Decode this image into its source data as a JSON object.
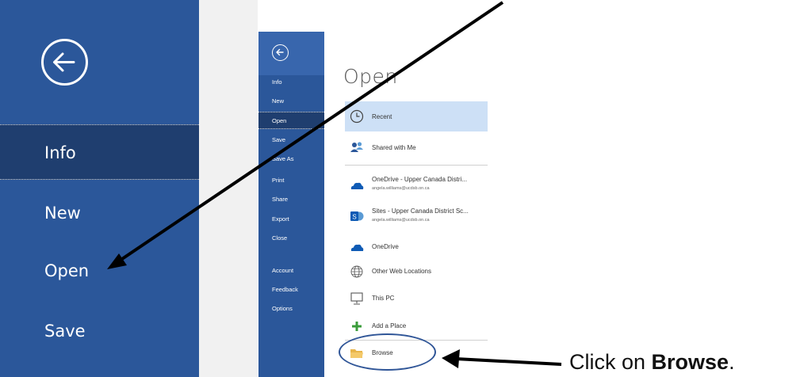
{
  "left_panel": {
    "items": [
      {
        "label": "Info",
        "selected": true
      },
      {
        "label": "New",
        "selected": false
      },
      {
        "label": "Open",
        "selected": false
      },
      {
        "label": "Save",
        "selected": false
      }
    ]
  },
  "screenshot": {
    "title": "Open",
    "sidebar_items": [
      {
        "label": "Info",
        "selected": false
      },
      {
        "label": "New",
        "selected": false
      },
      {
        "label": "Open",
        "selected": true
      },
      {
        "label": "Save",
        "selected": false
      },
      {
        "label": "Save As",
        "selected": false
      },
      {
        "label": "Print",
        "selected": false
      },
      {
        "label": "Share",
        "selected": false
      },
      {
        "label": "Export",
        "selected": false
      },
      {
        "label": "Close",
        "selected": false
      },
      {
        "label": "Account",
        "selected": false
      },
      {
        "label": "Feedback",
        "selected": false
      },
      {
        "label": "Options",
        "selected": false
      }
    ],
    "places": [
      {
        "label": "Recent",
        "sub": "",
        "icon": "clock-icon",
        "selected": true
      },
      {
        "label": "Shared with Me",
        "sub": "",
        "icon": "people-icon",
        "selected": false
      },
      {
        "label": "OneDrive - Upper Canada Distri...",
        "sub": "angela.williams@ucdsb.on.ca",
        "icon": "onedrive-cloud-icon",
        "selected": false
      },
      {
        "label": "Sites - Upper Canada District Sc...",
        "sub": "angela.williams@ucdsb.on.ca",
        "icon": "sharepoint-icon",
        "selected": false
      },
      {
        "label": "OneDrive",
        "sub": "",
        "icon": "onedrive-cloud-icon",
        "selected": false
      },
      {
        "label": "Other Web Locations",
        "sub": "",
        "icon": "globe-icon",
        "selected": false
      },
      {
        "label": "This PC",
        "sub": "",
        "icon": "computer-icon",
        "selected": false
      },
      {
        "label": "Add a Place",
        "sub": "",
        "icon": "plus-icon",
        "selected": false
      },
      {
        "label": "Browse",
        "sub": "",
        "icon": "folder-icon",
        "selected": false
      }
    ]
  },
  "callout": {
    "prefix": "Click on ",
    "bold": "Browse",
    "suffix": "."
  },
  "colors": {
    "sidebar_blue": "#2b579a",
    "selected_dark": "#1f3e6f",
    "selected_light": "#cde0f6",
    "annotation_oval": "#2f5597"
  }
}
